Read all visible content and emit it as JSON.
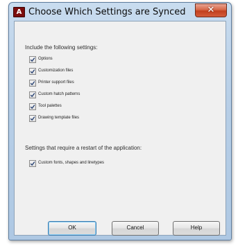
{
  "window": {
    "title": "Choose Which Settings are Synced",
    "icon": "autocad-app-icon",
    "close_label": "✕"
  },
  "main": {
    "include_heading": "Include the following settings:",
    "settings": [
      {
        "label": "Options",
        "checked": true
      },
      {
        "label": "Customization files",
        "checked": true
      },
      {
        "label": "Printer support files",
        "checked": true
      },
      {
        "label": "Custom hatch patterns",
        "checked": true
      },
      {
        "label": "Tool palettes",
        "checked": true
      },
      {
        "label": "Drawing template files",
        "checked": true
      }
    ],
    "restart_heading": "Settings that require a restart of the application:",
    "restart_settings": [
      {
        "label": "Custom fonts, shapes and linetypes",
        "checked": true
      }
    ]
  },
  "buttons": {
    "ok": "OK",
    "cancel": "Cancel",
    "help": "Help"
  }
}
